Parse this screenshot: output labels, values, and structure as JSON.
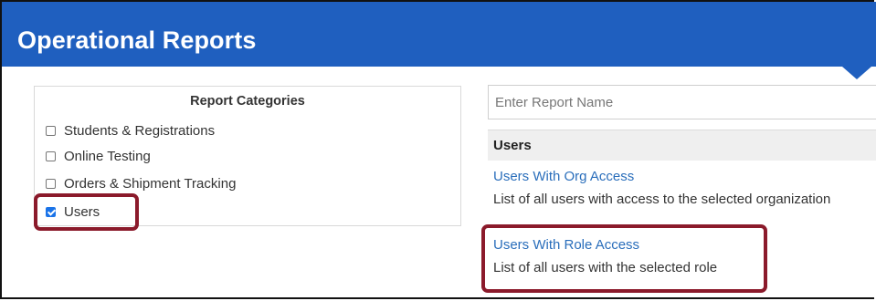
{
  "header": {
    "title": "Operational Reports"
  },
  "categories": {
    "title": "Report Categories",
    "items": [
      {
        "label": "Students & Registrations",
        "checked": false
      },
      {
        "label": "Online Testing",
        "checked": false
      },
      {
        "label": "Orders & Shipment Tracking",
        "checked": false
      },
      {
        "label": "Users",
        "checked": true
      }
    ]
  },
  "search": {
    "placeholder": "Enter Report Name",
    "value": ""
  },
  "reports": {
    "section_title": "Users",
    "items": [
      {
        "title": "Users With Org Access",
        "description": "List of all users with access to the selected organization"
      },
      {
        "title": "Users With Role Access",
        "description": "List of all users with the selected role"
      }
    ]
  },
  "colors": {
    "header_bg": "#1f5fbf",
    "link": "#2a6ebb",
    "highlight_border": "#8b1a2b",
    "checkbox_checked": "#1a73e8"
  }
}
